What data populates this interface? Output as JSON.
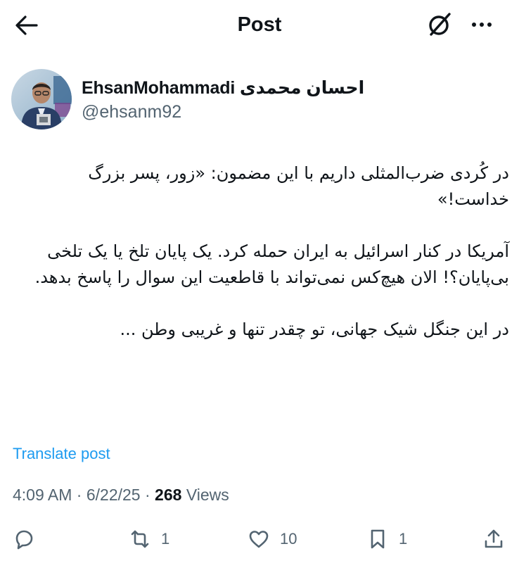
{
  "header": {
    "title": "Post"
  },
  "author": {
    "display_name": "EhsanMohammadi احسان محمدی",
    "handle": "@ehsanm92"
  },
  "post": {
    "paragraphs": [
      "در کُردی ضرب‌المثلی داریم با این مضمون: «زور، پسر بزرگ خداست!»",
      "آمریکا در کنار اسرائیل به ایران حمله کرد. یک پایان تلخ یا یک تلخی بی‌پایان؟! الان هیچ‌کس نمی‌تواند با قاطعیت این سوال را پاسخ بدهد.",
      "در این جنگل شیک جهانی، تو چقدر تنها و غریبی وطن ..."
    ],
    "translate_label": "Translate post"
  },
  "meta": {
    "time": "4:09 AM",
    "separator": "·",
    "date": "6/22/25",
    "views_count": "268",
    "views_label": "Views"
  },
  "actions": {
    "reply_icon": "reply-icon",
    "repost_count": "1",
    "like_count": "10",
    "bookmark_count": "1",
    "share_icon": "share-icon"
  },
  "colors": {
    "link": "#1d9bf0",
    "secondary_text": "#536471",
    "primary_text": "#0f1419"
  }
}
